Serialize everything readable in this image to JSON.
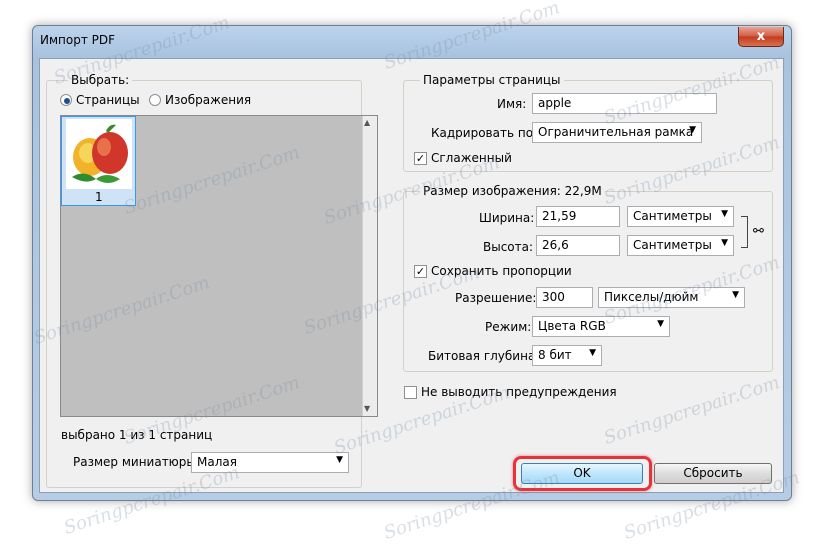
{
  "window": {
    "title": "Импорт PDF",
    "close_glyph": "x"
  },
  "select_group": {
    "legend": "Выбрать:",
    "radio_pages": "Страницы",
    "radio_images": "Изображения",
    "selected": "pages",
    "thumb_number": "1",
    "status": "выбрано 1 из 1 страниц",
    "thumb_size_label": "Размер миниатюры:",
    "thumb_size_value": "Малая"
  },
  "page_params": {
    "legend": "Параметры страницы",
    "name_label": "Имя:",
    "name_value": "apple",
    "crop_label": "Кадрировать по:",
    "crop_value": "Ограничительная рамка",
    "antialias_label": "Сглаженный",
    "antialias_checked": true
  },
  "image_size": {
    "legend": "Размер изображения: 22,9M",
    "width_label": "Ширина:",
    "width_value": "21,59",
    "width_unit": "Сантиметры",
    "height_label": "Высота:",
    "height_value": "26,6",
    "height_unit": "Сантиметры",
    "constrain_label": "Сохранить пропорции",
    "constrain_checked": true,
    "resolution_label": "Разрешение:",
    "resolution_value": "300",
    "resolution_unit": "Пикселы/дюйм",
    "mode_label": "Режим:",
    "mode_value": "Цвета RGB",
    "depth_label": "Битовая глубина:",
    "depth_value": "8 бит"
  },
  "suppress_warnings_label": "Не выводить предупреждения",
  "buttons": {
    "ok": "OK",
    "reset": "Сбросить"
  },
  "watermark": "Soringpcrepair.Com",
  "colors": {
    "highlight": "#e3343c",
    "selection": "#3399ff"
  }
}
